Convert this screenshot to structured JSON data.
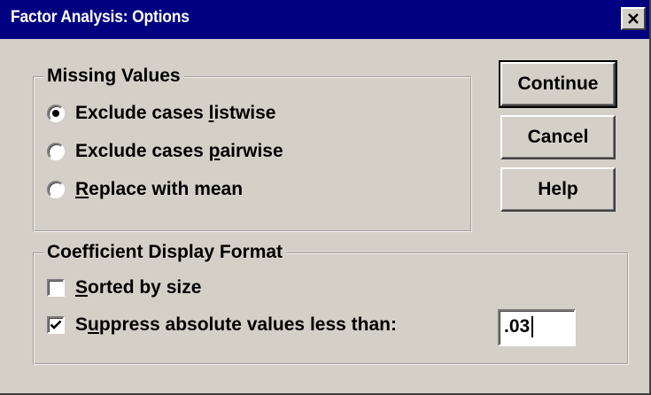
{
  "window": {
    "title": "Factor Analysis: Options"
  },
  "missing_values": {
    "legend": "Missing Values",
    "options": [
      {
        "before": "Exclude cases ",
        "mnemonic": "l",
        "after": "istwise",
        "selected": true
      },
      {
        "before": "Exclude cases ",
        "mnemonic": "p",
        "after": "airwise",
        "selected": false
      },
      {
        "before": "",
        "mnemonic": "R",
        "after": "eplace with mean",
        "selected": false
      }
    ]
  },
  "coefficient_format": {
    "legend": "Coefficient Display Format",
    "sorted": {
      "before": "",
      "mnemonic": "S",
      "after": "orted by size",
      "checked": false
    },
    "suppress": {
      "before": "S",
      "mnemonic": "u",
      "after": "ppress absolute values less than:",
      "checked": true
    },
    "suppress_value": ".03"
  },
  "buttons": {
    "continue": "Continue",
    "cancel": "Cancel",
    "help": "Help"
  },
  "colors": {
    "titlebar": "#000080",
    "dialog_face": "#d4d0c8"
  }
}
